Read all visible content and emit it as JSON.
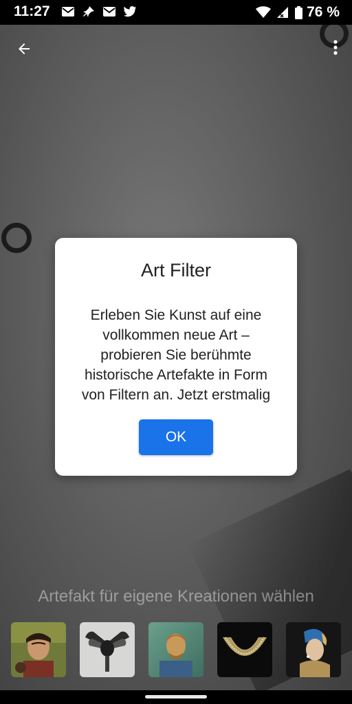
{
  "status_bar": {
    "time": "11:27",
    "battery": "76 %"
  },
  "toolbar": {
    "back_icon": "arrow-back-icon",
    "more_icon": "more-vert-icon"
  },
  "dialog": {
    "title": "Art Filter",
    "body_lines": [
      "Erleben Sie Kunst auf eine",
      "vollkommen neue Art –",
      "probieren Sie berühmte",
      "historische Artefakte in Form",
      "von Filtern an. Jetzt erstmalig"
    ],
    "ok_label": "OK"
  },
  "carousel": {
    "prompt": "Artefakt für eigene Kreationen wählen",
    "items": [
      {
        "name": "frida-portrait"
      },
      {
        "name": "feather-headdress"
      },
      {
        "name": "van-gogh-portrait"
      },
      {
        "name": "gold-collar-necklace"
      },
      {
        "name": "girl-with-pearl-earring"
      }
    ]
  },
  "colors": {
    "accent": "#1a73e8",
    "dialog_bg": "#ffffff"
  }
}
